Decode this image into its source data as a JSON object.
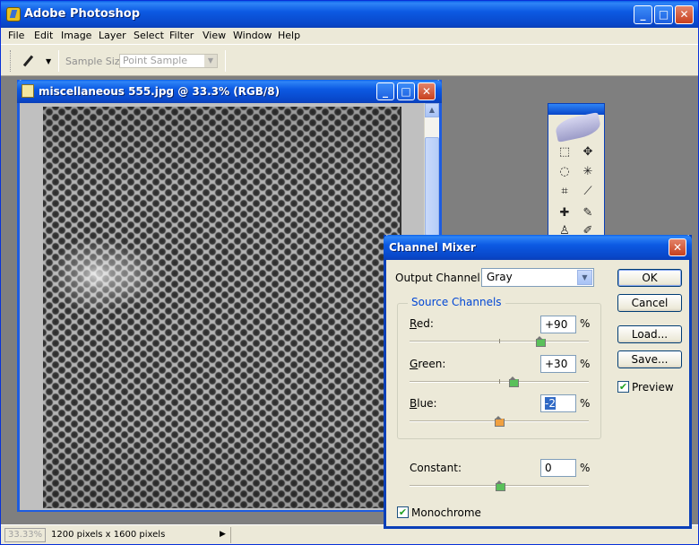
{
  "app": {
    "title": "Adobe Photoshop",
    "menu": [
      "File",
      "Edit",
      "Image",
      "Layer",
      "Select",
      "Filter",
      "View",
      "Window",
      "Help"
    ],
    "options": {
      "sample_size_label": "Sample Size:",
      "sample_size_value": "Point Sample"
    },
    "window_buttons": {
      "minimize": "_",
      "maximize": "□",
      "close": "✕"
    }
  },
  "document": {
    "title": "miscellaneous 555.jpg @ 33.3% (RGB/8)"
  },
  "statusbar": {
    "zoom": "33.33%",
    "doc_info": "1200 pixels x 1600 pixels",
    "arrow": "▶"
  },
  "toolbox": {
    "tools": [
      "marquee-tool",
      "move-tool",
      "lasso-tool",
      "magic-wand-tool",
      "crop-tool",
      "slice-tool",
      "healing-brush-tool",
      "brush-tool",
      "stamp-tool",
      "history-brush-tool"
    ]
  },
  "channel_mixer": {
    "title": "Channel Mixer",
    "output_channel_label": "Output Channel:",
    "output_channel_value": "Gray",
    "source_channels_title": "Source Channels",
    "channels": [
      {
        "key": "R",
        "label_rest": "ed:",
        "value": "+90",
        "level": 90,
        "thumb": "green"
      },
      {
        "key": "G",
        "label_rest": "reen:",
        "value": "+30",
        "level": 30,
        "thumb": "green"
      },
      {
        "key": "B",
        "label_rest": "lue:",
        "value": "-2",
        "level": -2,
        "thumb": "orange"
      }
    ],
    "constant": {
      "label": "Constant:",
      "value": "0",
      "level": 0
    },
    "percent": "%",
    "buttons": {
      "ok": "OK",
      "cancel": "Cancel",
      "load": "Load...",
      "save": "Save..."
    },
    "preview": {
      "label": "Preview",
      "checked": true
    },
    "monochrome": {
      "label": "Monochrome",
      "checked": true
    },
    "close_glyph": "✕"
  }
}
